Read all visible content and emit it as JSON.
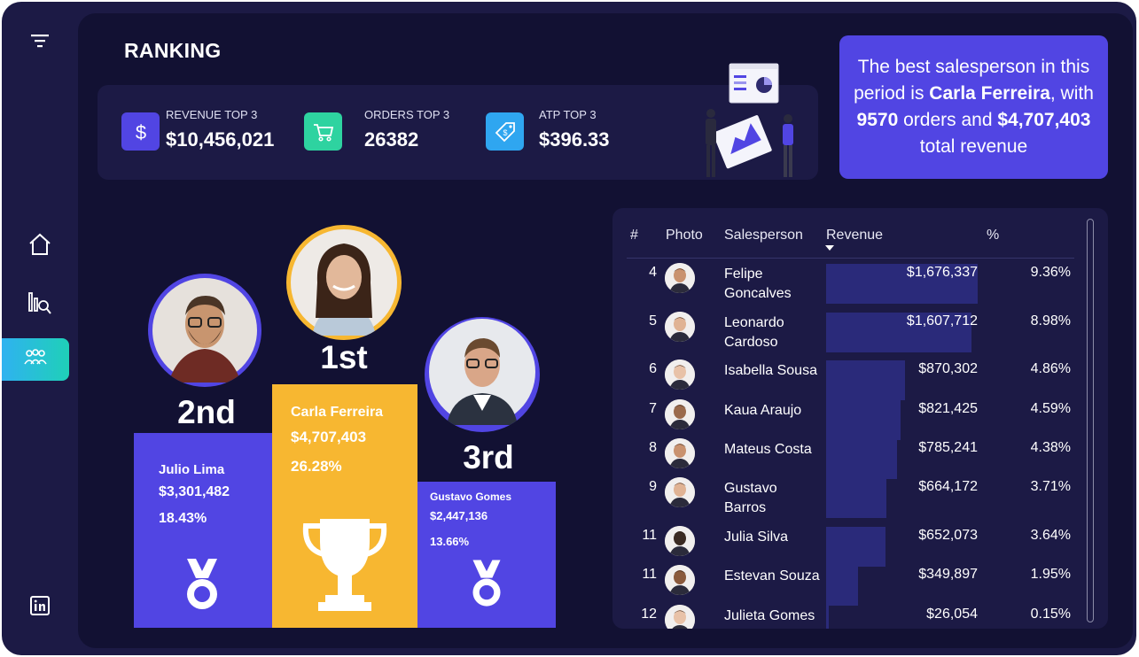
{
  "page": {
    "title": "RANKING"
  },
  "sidebar": {
    "items": [
      {
        "name": "filter",
        "icon": "filter-icon"
      },
      {
        "name": "home",
        "icon": "home-icon"
      },
      {
        "name": "analysis",
        "icon": "chart-search-icon"
      },
      {
        "name": "team",
        "icon": "team-icon",
        "active": true
      },
      {
        "name": "linkedin",
        "icon": "linkedin-icon"
      }
    ]
  },
  "kpis": [
    {
      "label": "REVENUE TOP 3",
      "value": "$10,456,021",
      "icon": "dollar-icon",
      "color": "#5145e3"
    },
    {
      "label": "ORDERS TOP 3",
      "value": "26382",
      "icon": "cart-icon",
      "color": "#2ed3a0"
    },
    {
      "label": "ATP TOP 3",
      "value": "$396.33",
      "icon": "tag-icon",
      "color": "#2fa6f0"
    }
  ],
  "best": {
    "p1": "The best salesperson in this period is ",
    "name": "Carla Ferreira",
    "p2": ", with ",
    "orders": "9570",
    "p3": " orders and ",
    "revenue": "$4,707,403",
    "p4": " total revenue"
  },
  "podium": {
    "first": {
      "rank": "1st",
      "name": "Carla Ferreira",
      "revenue": "$4,707,403",
      "pct": "26.28%",
      "color": "#f7b731"
    },
    "second": {
      "rank": "2nd",
      "name": "Julio Lima",
      "revenue": "$3,301,482",
      "pct": "18.43%",
      "color": "#5145e3"
    },
    "third": {
      "rank": "3rd",
      "name": "Gustavo Gomes",
      "revenue": "$2,447,136",
      "pct": "13.66%",
      "color": "#5145e3"
    }
  },
  "table": {
    "columns": [
      "#",
      "Photo",
      "Salesperson",
      "Revenue",
      "%"
    ],
    "max_revenue": 1676337,
    "rows": [
      {
        "num": "4",
        "name": "Felipe Goncalves",
        "revenue": "$1,676,337",
        "revenue_value": 1676337,
        "pct": "9.36%"
      },
      {
        "num": "5",
        "name": "Leonardo Cardoso",
        "revenue": "$1,607,712",
        "revenue_value": 1607712,
        "pct": "8.98%"
      },
      {
        "num": "6",
        "name": "Isabella Sousa",
        "revenue": "$870,302",
        "revenue_value": 870302,
        "pct": "4.86%"
      },
      {
        "num": "7",
        "name": "Kaua Araujo",
        "revenue": "$821,425",
        "revenue_value": 821425,
        "pct": "4.59%"
      },
      {
        "num": "8",
        "name": "Mateus Costa",
        "revenue": "$785,241",
        "revenue_value": 785241,
        "pct": "4.38%"
      },
      {
        "num": "9",
        "name": "Gustavo Barros",
        "revenue": "$664,172",
        "revenue_value": 664172,
        "pct": "3.71%"
      },
      {
        "num": "11",
        "name": "Julia Silva",
        "revenue": "$652,073",
        "revenue_value": 652073,
        "pct": "3.64%"
      },
      {
        "num": "11",
        "name": "Estevan Souza",
        "revenue": "$349,897",
        "revenue_value": 349897,
        "pct": "1.95%"
      },
      {
        "num": "12",
        "name": "Julieta Gomes",
        "revenue": "$26,054",
        "revenue_value": 26054,
        "pct": "0.15%"
      }
    ]
  }
}
